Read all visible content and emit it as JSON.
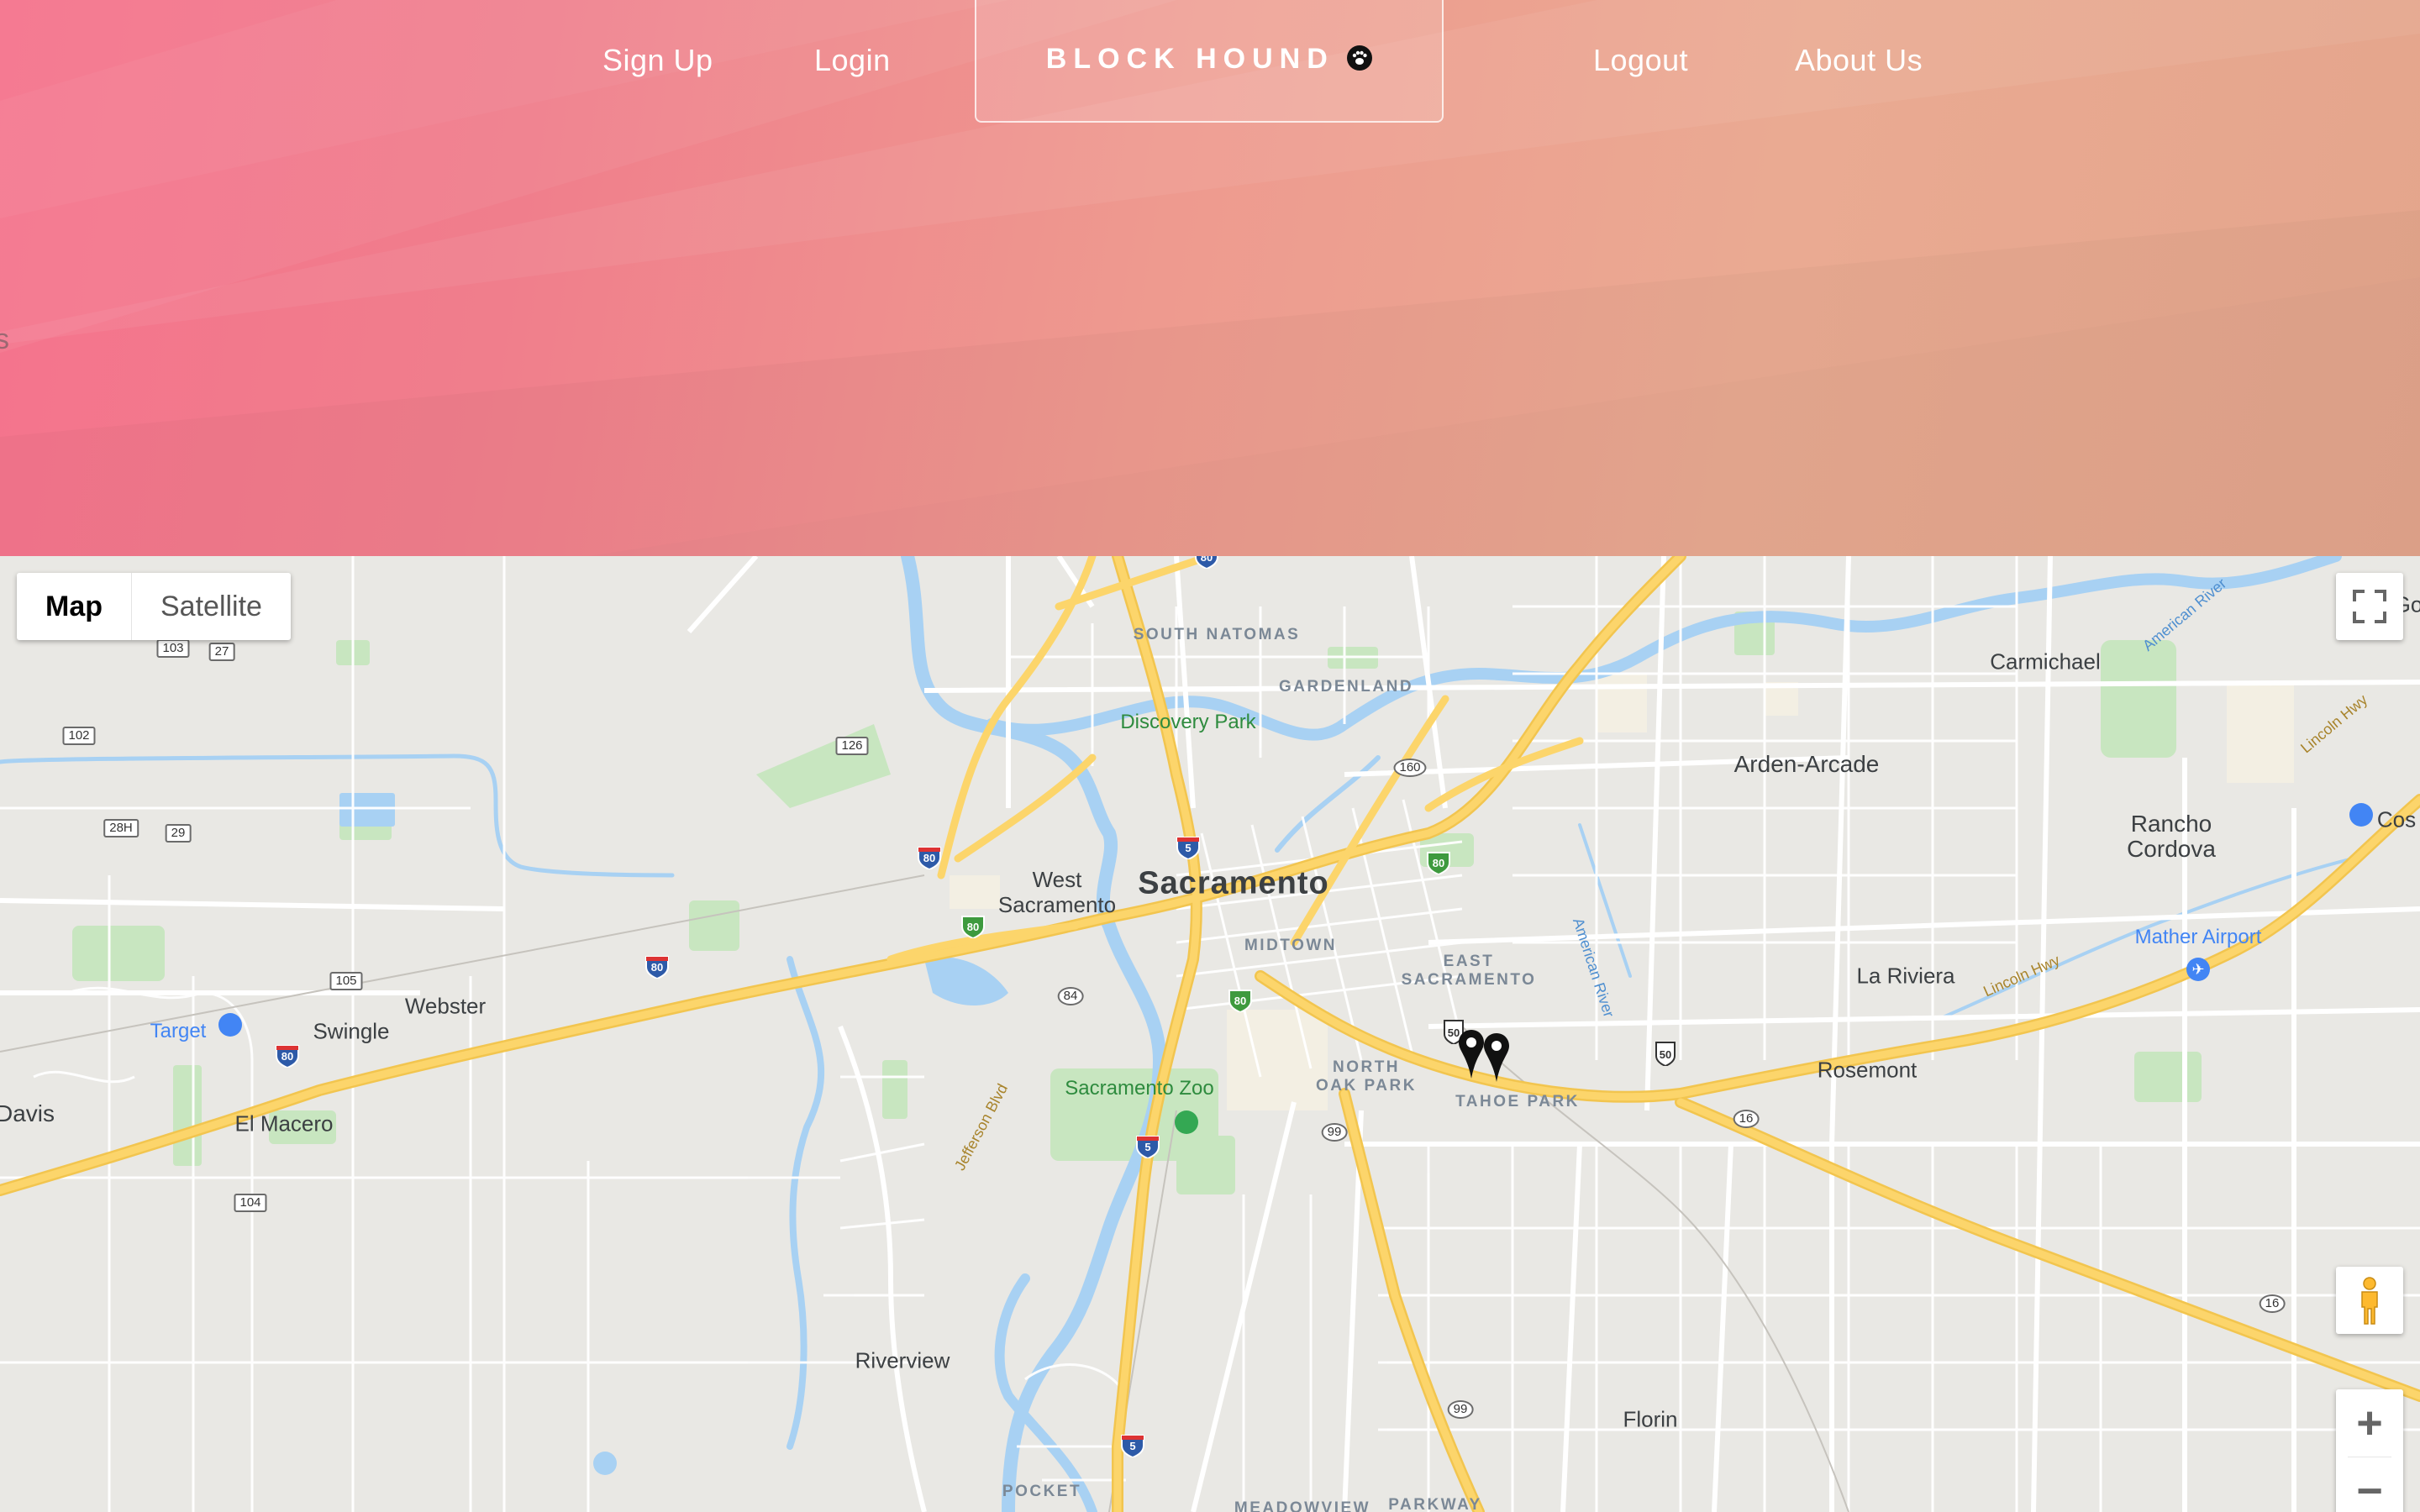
{
  "nav": {
    "links": [
      "Sign Up",
      "Login",
      "Logout",
      "About Us"
    ],
    "brand": "BLOCK HOUND",
    "brand_icon": "paw-icon",
    "edge_text": "s"
  },
  "colors": {
    "hero_start": "#f5738d",
    "hero_end": "#e4a58c",
    "map_land": "#e9e8e4",
    "map_water": "#a8d1f3",
    "map_highway": "#fcd56b",
    "map_park": "#c8e6c0"
  },
  "map": {
    "type_control": {
      "map": "Map",
      "satellite": "Satellite",
      "selected": "Map"
    },
    "controls": [
      "fullscreen-icon",
      "pegman-icon",
      "zoom-in-icon",
      "zoom-out-icon"
    ],
    "zoom_in": "+",
    "zoom_out": "−",
    "labels": {
      "sacramento": "Sacramento",
      "west_sacramento": "West\nSacramento",
      "arden_arcade": "Arden-Arcade",
      "carmichael": "Carmichael",
      "rancho_cordova": "Rancho\nCordova",
      "davis": "Davis",
      "el_macero": "El Macero",
      "swingle": "Swingle",
      "webster": "Webster",
      "riverview": "Riverview",
      "florin": "Florin",
      "rosemont": "Rosemont",
      "la_riviera": "La Riviera",
      "cos": "Cos",
      "go": "Go",
      "south_natomas": "SOUTH NATOMAS",
      "gardenland": "GARDENLAND",
      "midtown": "MIDTOWN",
      "east_sacramento": "EAST\nSACRAMENTO",
      "north_oak_park": "NORTH\nOAK PARK",
      "tahoe_park": "TAHOE PARK",
      "pocket": "POCKET",
      "meadowview": "MEADOWVIEW",
      "parkway": "PARKWAY",
      "discovery_park": "Discovery Park",
      "sacramento_zoo": "Sacramento Zoo",
      "target": "Target",
      "mather_airport": "Mather Airport",
      "american_river_1": "American River",
      "american_river_2": "American River",
      "jefferson_blvd": "Jefferson Blvd",
      "lincoln_hwy_1": "Lincoln Hwy",
      "lincoln_hwy_2": "Lincoln Hwy"
    },
    "shields": {
      "s103": "103",
      "s27": "27",
      "s102": "102",
      "s28h": "28H",
      "s29": "29",
      "s126": "126",
      "s105": "105",
      "s104": "104",
      "s84": "84",
      "s160": "160",
      "s99a": "99",
      "s99b": "99",
      "s16a": "16",
      "s16b": "16"
    },
    "interstates": {
      "i80a": "80",
      "i80b": "80",
      "i80c": "80",
      "i80d": "80",
      "i80e": "80",
      "i80f": "80",
      "i80g": "80",
      "i5a": "5",
      "i5b": "5",
      "i5c": "5",
      "us50a": "50",
      "us50b": "50"
    },
    "markers": 2
  }
}
